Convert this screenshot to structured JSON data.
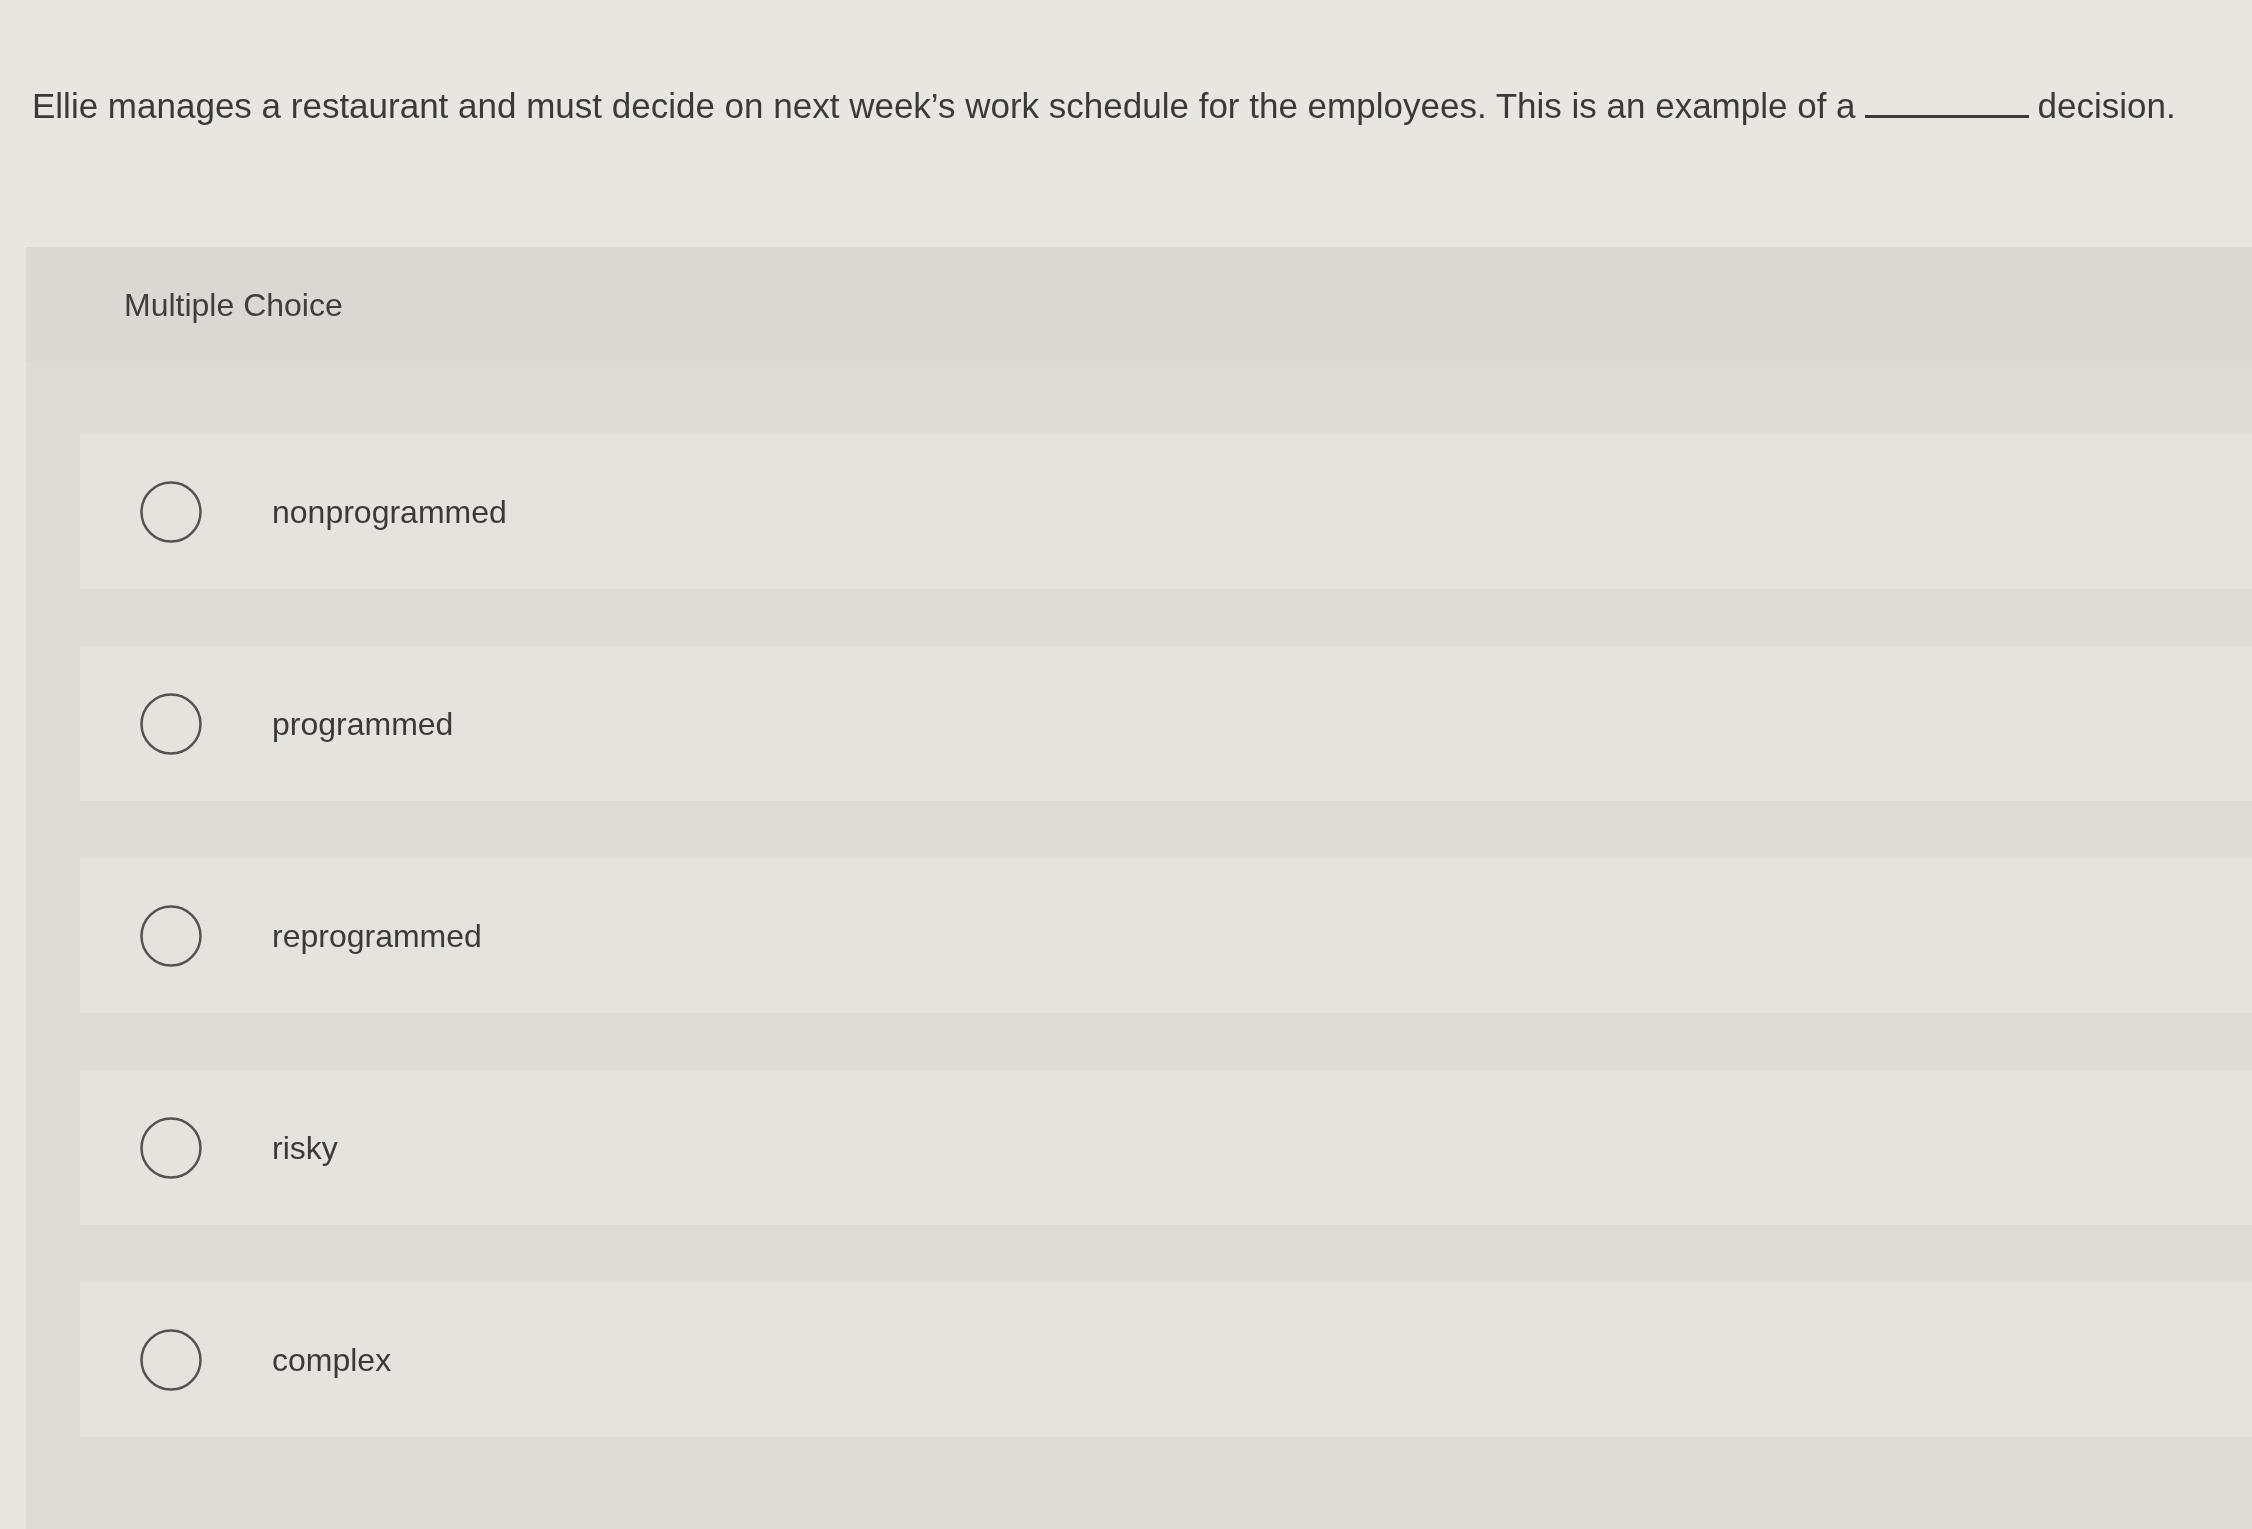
{
  "question": {
    "parts": [
      {
        "kind": "text",
        "text": "Ellie manages a restaurant and must decide on next week’s work schedule for the employees. This is an example of a"
      },
      {
        "kind": "blank"
      },
      {
        "kind": "text",
        "text": "decision."
      }
    ]
  },
  "panel": {
    "title": "Multiple Choice"
  },
  "options": [
    {
      "label": "nonprogrammed",
      "selected": false
    },
    {
      "label": "programmed",
      "selected": false
    },
    {
      "label": "reprogrammed",
      "selected": false
    },
    {
      "label": "risky",
      "selected": false
    },
    {
      "label": "complex",
      "selected": false
    }
  ]
}
